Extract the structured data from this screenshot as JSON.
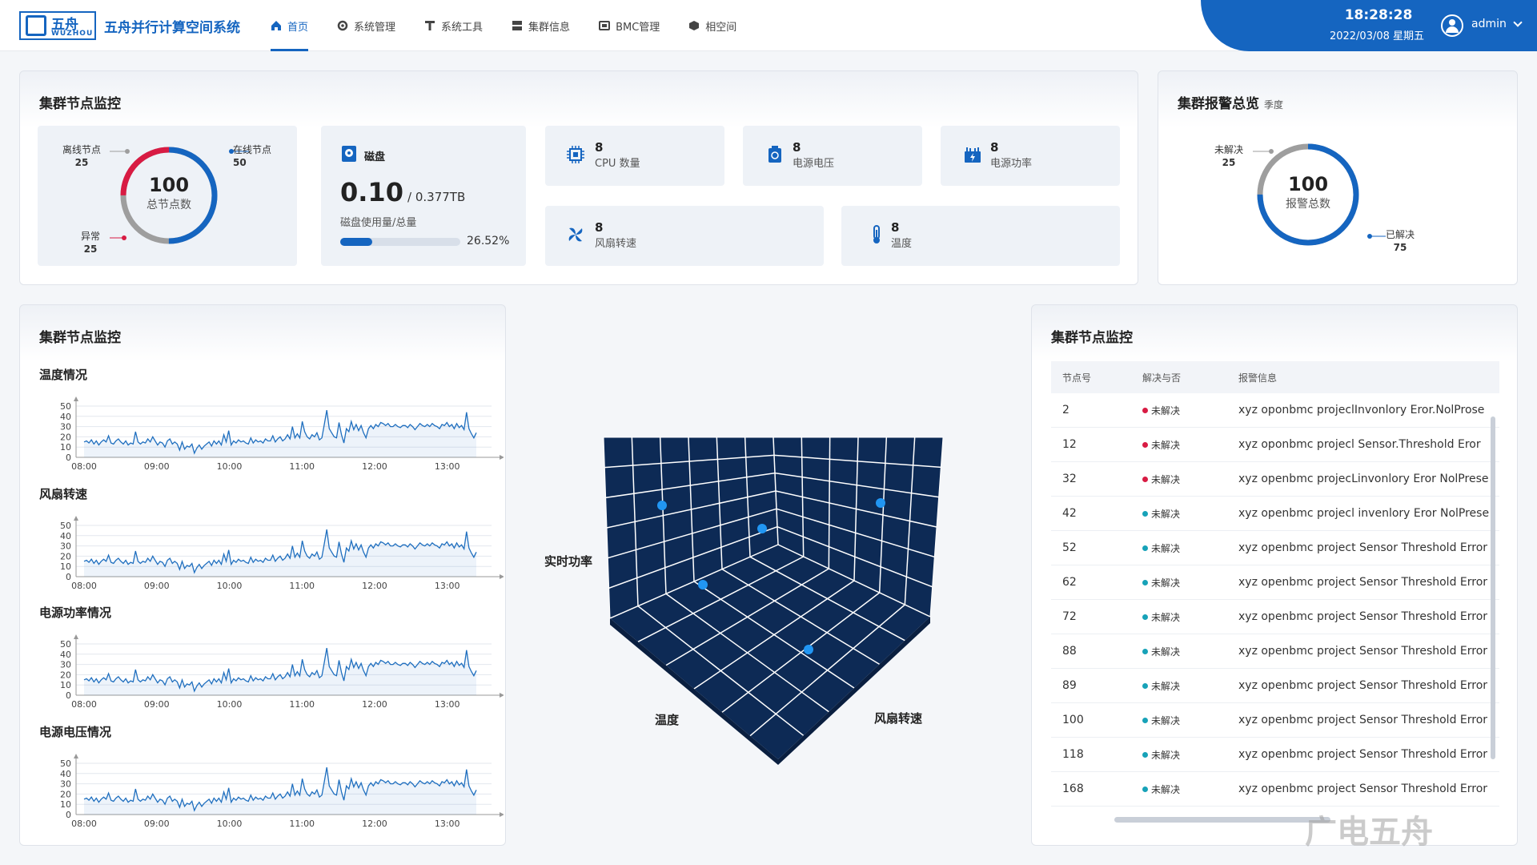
{
  "brand": {
    "logo_cn": "五舟",
    "logo_en": "WUZHOU",
    "app_title": "五舟并行计算空间系统"
  },
  "nav": [
    {
      "label": "首页",
      "icon": "home-icon",
      "active": true
    },
    {
      "label": "系统管理",
      "icon": "gear-icon"
    },
    {
      "label": "系统工具",
      "icon": "tool-icon"
    },
    {
      "label": "集群信息",
      "icon": "server-icon"
    },
    {
      "label": "BMC管理",
      "icon": "bmc-icon"
    },
    {
      "label": "相空间",
      "icon": "cube-icon"
    }
  ],
  "header": {
    "time": "18:28:28",
    "date": "2022/03/08 星期五",
    "user": "admin"
  },
  "node_monitor": {
    "title": "集群节点监控",
    "total": "100",
    "total_label": "总节点数",
    "offline_label": "离线节点",
    "offline": "25",
    "online_label": "在线节点",
    "online": "50",
    "abnormal_label": "异常",
    "abnormal": "25",
    "colors": {
      "online": "#1565c0",
      "offline": "#9e9e9e",
      "abnormal": "#d81b43"
    }
  },
  "disk": {
    "title": "磁盘",
    "used": "0.10",
    "total": "/ 0.377TB",
    "caption": "磁盘使用量/总量",
    "percent_text": "26.52%",
    "percent": 26.52
  },
  "metrics": [
    {
      "value": "8",
      "label": "CPU 数量",
      "icon": "cpu-icon"
    },
    {
      "value": "8",
      "label": "电源电压",
      "icon": "power-supply-icon"
    },
    {
      "value": "8",
      "label": "电源功率",
      "icon": "power-meter-icon"
    },
    {
      "value": "8",
      "label": "风扇转速",
      "icon": "fan-icon"
    },
    {
      "value": "8",
      "label": "温度",
      "icon": "thermometer-icon"
    }
  ],
  "alarm_overview": {
    "title": "集群报警总览",
    "subtitle": "季度",
    "total": "100",
    "total_label": "报警总数",
    "unresolved_label": "未解决",
    "unresolved": "25",
    "resolved_label": "已解决",
    "resolved": "75"
  },
  "line_panel": {
    "title": "集群节点监控"
  },
  "chart_data": [
    {
      "type": "line",
      "title": "温度情况",
      "x": [
        "08:00",
        "09:00",
        "10:00",
        "11:00",
        "12:00",
        "13:00"
      ],
      "ylim": [
        0,
        50
      ],
      "yticks": [
        0,
        10,
        20,
        30,
        40,
        50
      ],
      "values": [
        15,
        16,
        14,
        17,
        13,
        16,
        12,
        15,
        17,
        15,
        21,
        14,
        13,
        16,
        18,
        15,
        13,
        16,
        12,
        14,
        13,
        25,
        15,
        13,
        15,
        14,
        18,
        15,
        20,
        16,
        12,
        15,
        14,
        10,
        16,
        18,
        13,
        15,
        13,
        7,
        15,
        8,
        11,
        10,
        13,
        4,
        9,
        12,
        8,
        11,
        13,
        15,
        11,
        16,
        13,
        16,
        12,
        22,
        15,
        26,
        12,
        16,
        14,
        17,
        15,
        16,
        14,
        13,
        19,
        14,
        17,
        15,
        16,
        14,
        18,
        16,
        16,
        21,
        15,
        18,
        20,
        16,
        18,
        22,
        18,
        30,
        19,
        23,
        19,
        35,
        25,
        20,
        18,
        22,
        20,
        24,
        17,
        19,
        32,
        46,
        28,
        24,
        20,
        19,
        34,
        22,
        14,
        28,
        25,
        35,
        27,
        32,
        26,
        31,
        24,
        19,
        28,
        31,
        28,
        32,
        30,
        34,
        33,
        31,
        33,
        30,
        30,
        32,
        30,
        29,
        31,
        31,
        29,
        32,
        30,
        27,
        30,
        33,
        31,
        30,
        32,
        30,
        33,
        31,
        30,
        28,
        32,
        31,
        34,
        30,
        32,
        28,
        33,
        29,
        31,
        27,
        44,
        28,
        23,
        19,
        24
      ]
    },
    {
      "type": "line",
      "title": "风扇转速",
      "x": [
        "08:00",
        "09:00",
        "10:00",
        "11:00",
        "12:00",
        "13:00"
      ],
      "ylim": [
        0,
        50
      ],
      "yticks": [
        0,
        10,
        20,
        30,
        40,
        50
      ],
      "values": [
        15,
        16,
        14,
        17,
        13,
        16,
        12,
        15,
        17,
        15,
        21,
        14,
        13,
        16,
        18,
        15,
        13,
        16,
        12,
        14,
        13,
        25,
        15,
        13,
        15,
        14,
        18,
        15,
        20,
        16,
        12,
        15,
        14,
        10,
        16,
        18,
        13,
        15,
        13,
        7,
        15,
        8,
        11,
        10,
        13,
        4,
        9,
        12,
        8,
        11,
        13,
        15,
        11,
        16,
        13,
        16,
        12,
        22,
        15,
        26,
        12,
        16,
        14,
        17,
        15,
        16,
        14,
        13,
        19,
        14,
        17,
        15,
        16,
        14,
        18,
        16,
        16,
        21,
        15,
        18,
        20,
        16,
        18,
        22,
        18,
        30,
        19,
        23,
        19,
        35,
        25,
        20,
        18,
        22,
        20,
        24,
        17,
        19,
        32,
        46,
        28,
        24,
        20,
        19,
        34,
        22,
        14,
        28,
        25,
        35,
        27,
        32,
        26,
        31,
        24,
        19,
        28,
        31,
        28,
        32,
        30,
        34,
        33,
        31,
        33,
        30,
        30,
        32,
        30,
        29,
        31,
        31,
        29,
        32,
        30,
        27,
        30,
        33,
        31,
        30,
        32,
        30,
        33,
        31,
        30,
        28,
        32,
        31,
        34,
        30,
        32,
        28,
        33,
        29,
        31,
        27,
        44,
        28,
        23,
        19,
        24
      ]
    },
    {
      "type": "line",
      "title": "电源功率情况",
      "x": [
        "08:00",
        "09:00",
        "10:00",
        "11:00",
        "12:00",
        "13:00"
      ],
      "ylim": [
        0,
        50
      ],
      "yticks": [
        0,
        10,
        20,
        30,
        40,
        50
      ],
      "values": [
        15,
        16,
        14,
        17,
        13,
        16,
        12,
        15,
        17,
        15,
        21,
        14,
        13,
        16,
        18,
        15,
        13,
        16,
        12,
        14,
        13,
        25,
        15,
        13,
        15,
        14,
        18,
        15,
        20,
        16,
        12,
        15,
        14,
        10,
        16,
        18,
        13,
        15,
        13,
        7,
        15,
        8,
        11,
        10,
        13,
        4,
        9,
        12,
        8,
        11,
        13,
        15,
        11,
        16,
        13,
        16,
        12,
        22,
        15,
        26,
        12,
        16,
        14,
        17,
        15,
        16,
        14,
        13,
        19,
        14,
        17,
        15,
        16,
        14,
        18,
        16,
        16,
        21,
        15,
        18,
        20,
        16,
        18,
        22,
        18,
        30,
        19,
        23,
        19,
        35,
        25,
        20,
        18,
        22,
        20,
        24,
        17,
        19,
        32,
        46,
        28,
        24,
        20,
        19,
        34,
        22,
        14,
        28,
        25,
        35,
        27,
        32,
        26,
        31,
        24,
        19,
        28,
        31,
        28,
        32,
        30,
        34,
        33,
        31,
        33,
        30,
        30,
        32,
        30,
        29,
        31,
        31,
        29,
        32,
        30,
        27,
        30,
        33,
        31,
        30,
        32,
        30,
        33,
        31,
        30,
        28,
        32,
        31,
        34,
        30,
        32,
        28,
        33,
        29,
        31,
        27,
        44,
        28,
        23,
        19,
        24
      ]
    },
    {
      "type": "line",
      "title": "电源电压情况",
      "x": [
        "08:00",
        "09:00",
        "10:00",
        "11:00",
        "12:00",
        "13:00"
      ],
      "ylim": [
        0,
        50
      ],
      "yticks": [
        0,
        10,
        20,
        30,
        40,
        50
      ],
      "values": [
        15,
        16,
        14,
        17,
        13,
        16,
        12,
        15,
        17,
        15,
        21,
        14,
        13,
        16,
        18,
        15,
        13,
        16,
        12,
        14,
        13,
        25,
        15,
        13,
        15,
        14,
        18,
        15,
        20,
        16,
        12,
        15,
        14,
        10,
        16,
        18,
        13,
        15,
        13,
        7,
        15,
        8,
        11,
        10,
        13,
        4,
        9,
        12,
        8,
        11,
        13,
        15,
        11,
        16,
        13,
        16,
        12,
        22,
        15,
        26,
        12,
        16,
        14,
        17,
        15,
        16,
        14,
        13,
        19,
        14,
        17,
        15,
        16,
        14,
        18,
        16,
        16,
        21,
        15,
        18,
        20,
        16,
        18,
        22,
        18,
        30,
        19,
        23,
        19,
        35,
        25,
        20,
        18,
        22,
        20,
        24,
        17,
        19,
        32,
        46,
        28,
        24,
        20,
        19,
        34,
        22,
        14,
        28,
        25,
        35,
        27,
        32,
        26,
        31,
        24,
        19,
        28,
        31,
        28,
        32,
        30,
        34,
        33,
        31,
        33,
        30,
        30,
        32,
        30,
        29,
        31,
        31,
        29,
        32,
        30,
        27,
        30,
        33,
        31,
        30,
        32,
        30,
        33,
        31,
        30,
        28,
        32,
        31,
        34,
        30,
        32,
        28,
        33,
        29,
        31,
        27,
        44,
        28,
        23,
        19,
        24
      ]
    },
    {
      "type": "scatter",
      "x_label": "温度",
      "y_label": "风扇转速",
      "z_label": "实时功率",
      "grid": true
    }
  ],
  "alarm_table": {
    "title": "集群节点监控",
    "columns": [
      "节点号",
      "解决与否",
      "报警信息"
    ],
    "rows": [
      {
        "node": "2",
        "status": "未解决",
        "status_color": "#d81b43",
        "message": "xyz oponbmc projeclInvonlory Eror.NolProse"
      },
      {
        "node": "12",
        "status": "未解决",
        "status_color": "#d81b43",
        "message": "xyz oponbmc projecl Sensor.Threshold Eror"
      },
      {
        "node": "32",
        "status": "未解决",
        "status_color": "#d81b43",
        "message": "xyz openbmc projecLinvonlory Eror NolPrese"
      },
      {
        "node": "42",
        "status": "未解决",
        "status_color": "#17a2b8",
        "message": "xyz openbmc projecl invenlory Eror NolPrese"
      },
      {
        "node": "52",
        "status": "未解决",
        "status_color": "#17a2b8",
        "message": "xyz openbmc project Sensor Threshold Error"
      },
      {
        "node": "62",
        "status": "未解决",
        "status_color": "#17a2b8",
        "message": "xyz openbmc project Sensor Threshold Error"
      },
      {
        "node": "72",
        "status": "未解决",
        "status_color": "#17a2b8",
        "message": "xyz openbmc project Sensor Threshold Error"
      },
      {
        "node": "88",
        "status": "未解决",
        "status_color": "#17a2b8",
        "message": "xyz openbmc project Sensor Threshold Error"
      },
      {
        "node": "89",
        "status": "未解决",
        "status_color": "#17a2b8",
        "message": "xyz openbmc project Sensor Threshold Error"
      },
      {
        "node": "100",
        "status": "未解决",
        "status_color": "#17a2b8",
        "message": "xyz openbmc project Sensor Threshold Error"
      },
      {
        "node": "118",
        "status": "未解决",
        "status_color": "#17a2b8",
        "message": "xyz openbmc project Sensor Threshold Error"
      },
      {
        "node": "168",
        "status": "未解决",
        "status_color": "#17a2b8",
        "message": "xyz openbmc project Sensor Threshold Error"
      }
    ]
  },
  "watermark": "广电五舟"
}
